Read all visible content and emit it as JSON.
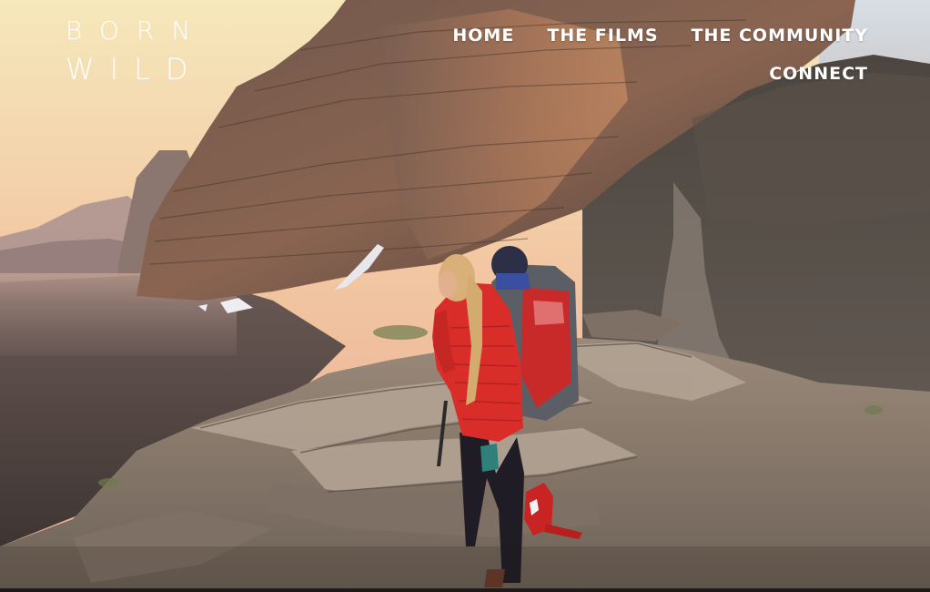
{
  "logo": {
    "line1": "BORN",
    "line2": "WILD"
  },
  "nav": {
    "home": "HOME",
    "films": "THE FILMS",
    "community": "THE COMMUNITY",
    "connect": "CONNECT"
  },
  "colors": {
    "nav_text": "#ffffff",
    "sky_top": "#f7e3b0",
    "sky_bottom": "#f0b39a",
    "jacket": "#d92d2a"
  },
  "hero": {
    "subject": "hiker with child carrier on mountain ridge at sunset"
  }
}
